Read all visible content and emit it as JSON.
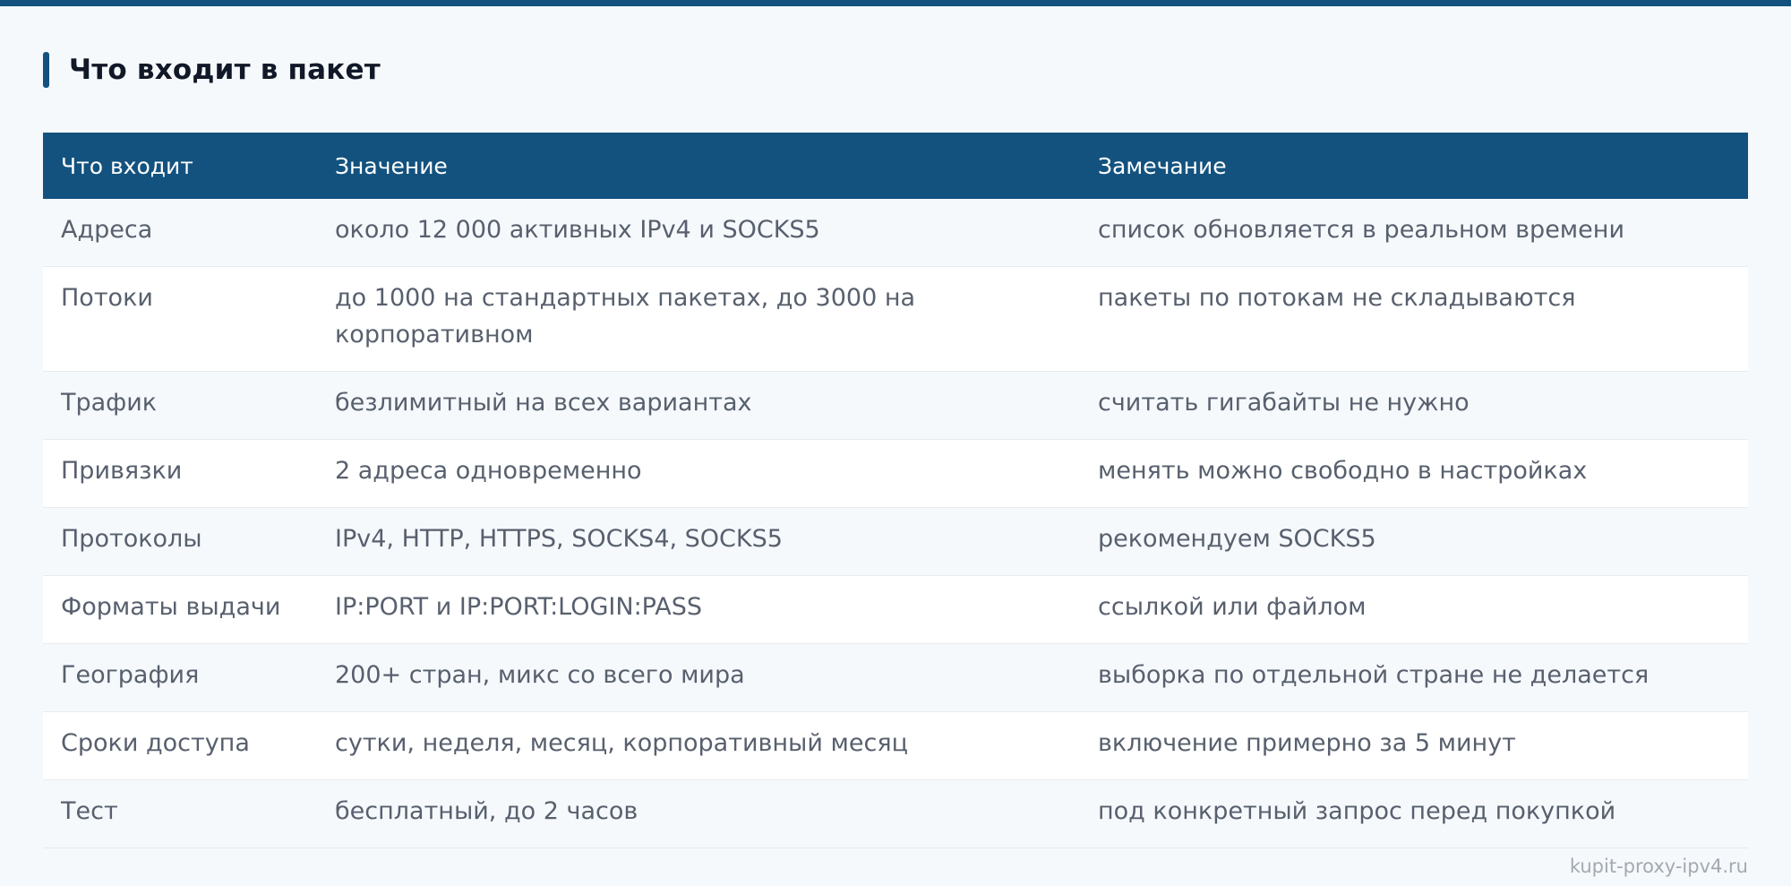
{
  "section": {
    "title": "Что входит в пакет"
  },
  "table": {
    "headers": [
      "Что входит",
      "Значение",
      "Замечание"
    ],
    "rows": [
      [
        "Адреса",
        "около 12 000 активных IPv4 и SOCKS5",
        "список обновляется в реальном времени"
      ],
      [
        "Потоки",
        "до 1000 на стандартных пакетах, до 3000 на корпоративном",
        "пакеты по потокам не складываются"
      ],
      [
        "Трафик",
        "безлимитный на всех вариантах",
        "считать гигабайты не нужно"
      ],
      [
        "Привязки",
        "2 адреса одновременно",
        "менять можно свободно в настройках"
      ],
      [
        "Протоколы",
        "IPv4, HTTP, HTTPS, SOCKS4, SOCKS5",
        "рекомендуем SOCKS5"
      ],
      [
        "Форматы выдачи",
        "IP:PORT и IP:PORT:LOGIN:PASS",
        "ссылкой или файлом"
      ],
      [
        "География",
        "200+ стран, микс со всего мира",
        "выборка по отдельной стране не делается"
      ],
      [
        "Сроки доступа",
        "сутки, неделя, месяц, корпоративный месяц",
        "включение примерно за 5 минут"
      ],
      [
        "Тест",
        "бесплатный, до 2 часов",
        "под конкретный запрос перед покупкой"
      ]
    ]
  },
  "watermark": "kupit-proxy-ipv4.ru",
  "colors": {
    "accent": "#13527f",
    "background": "#f6f9fc",
    "text": "#58606e"
  }
}
